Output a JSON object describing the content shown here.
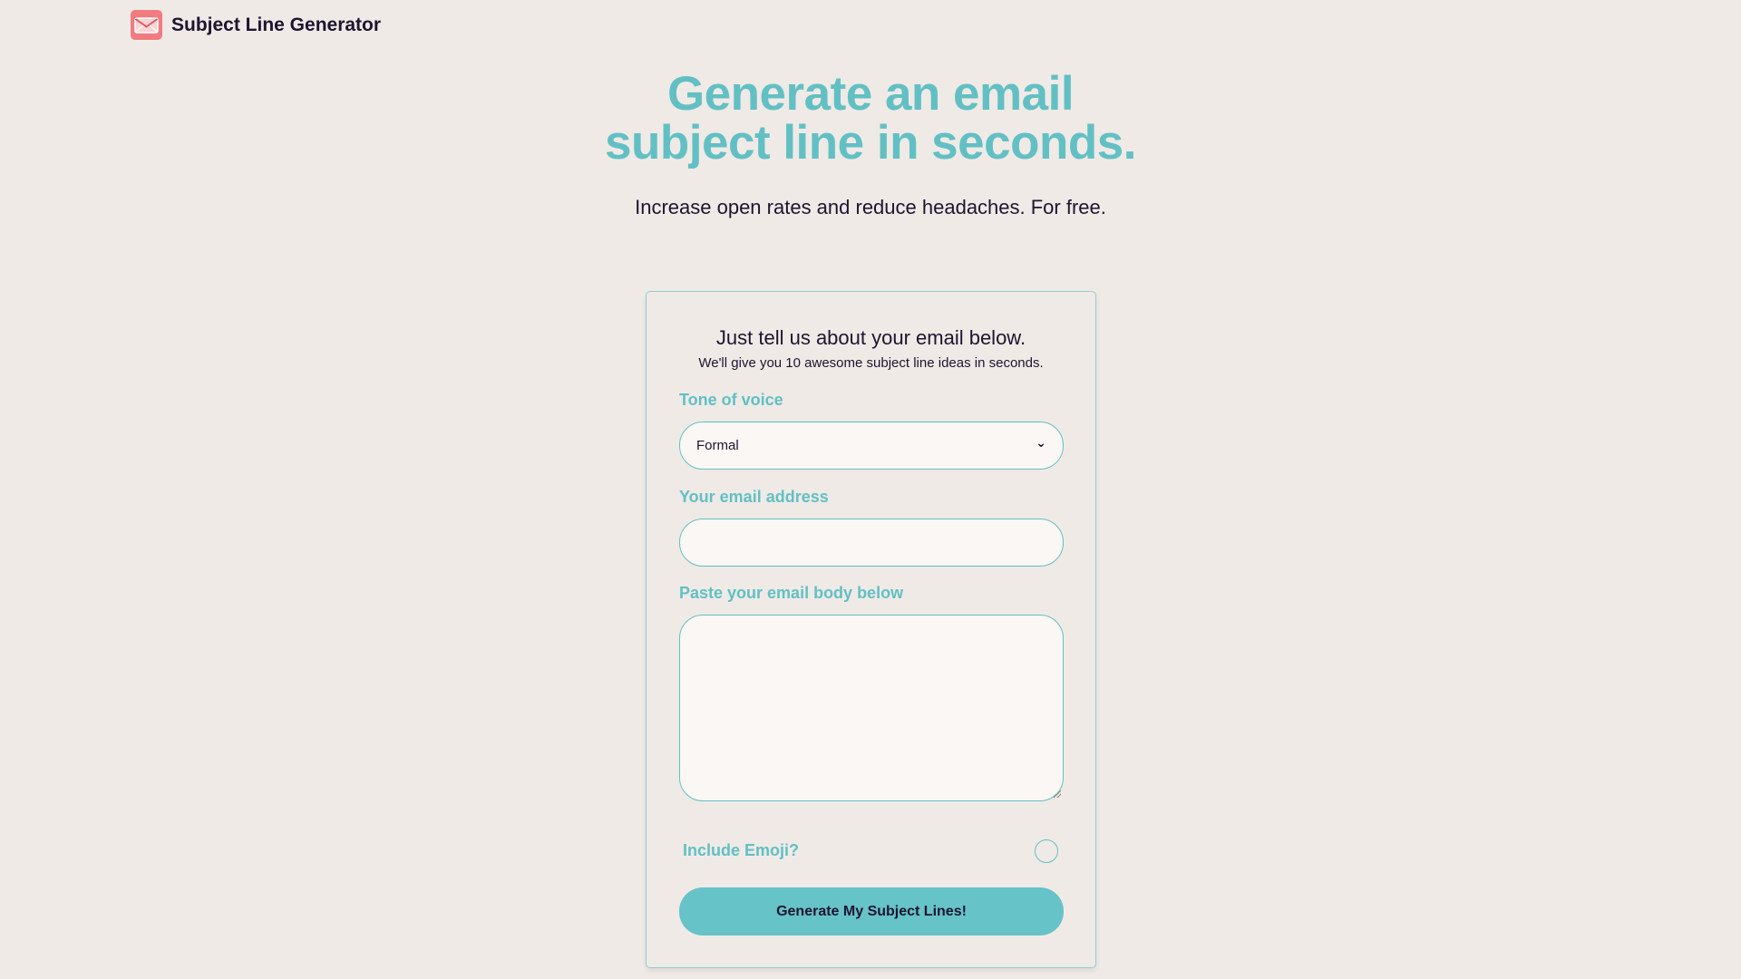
{
  "header": {
    "brand_name": "Subject Line Generator",
    "logo_icon": "envelope-icon",
    "logo_color": "#f07c80"
  },
  "hero": {
    "title_line1": "Generate an email",
    "title_line2": "subject line in seconds.",
    "subtitle": "Increase open rates and reduce headaches. For free."
  },
  "form": {
    "title": "Just tell us about your email below.",
    "subtitle": "We'll give you 10 awesome subject line ideas in seconds.",
    "tone": {
      "label": "Tone of voice",
      "selected": "Formal",
      "caret_icon": "chevron-down-icon"
    },
    "email": {
      "label": "Your email address",
      "value": "",
      "placeholder": ""
    },
    "body": {
      "label": "Paste your email body below",
      "value": "",
      "placeholder": ""
    },
    "emoji": {
      "label": "Include Emoji?",
      "checked": false
    },
    "submit_label": "Generate My Subject Lines!"
  },
  "colors": {
    "background": "#efeae6",
    "accent": "#62c0c4",
    "button": "#66c3c8",
    "text": "#1d1530",
    "logo": "#f07c80"
  }
}
